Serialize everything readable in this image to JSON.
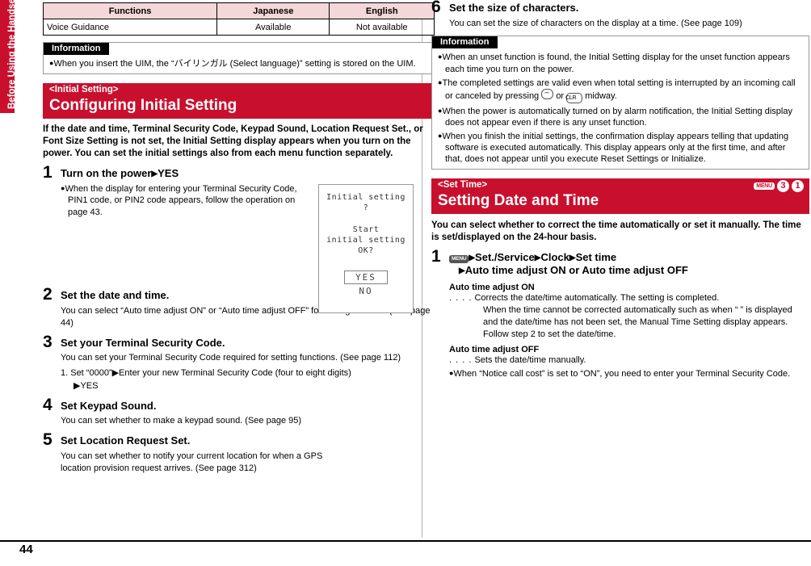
{
  "side_tab": {
    "label": "Before Using the Handset"
  },
  "page_number": "44",
  "left": {
    "table": {
      "headers": [
        "Functions",
        "Japanese",
        "English"
      ],
      "rows": [
        [
          "Voice Guidance",
          "Available",
          "Not available"
        ]
      ]
    },
    "information": {
      "title": "Information",
      "items": [
        "When you insert the UIM, the “バイリンガル (Select language)” setting is stored on the UIM."
      ]
    },
    "section": {
      "sub": "<Initial Setting>",
      "title": "Configuring Initial Setting"
    },
    "intro": "If the date and time, Terminal Security Code, Keypad Sound, Location Request Set., or Font Size Setting is not set, the Initial Setting display appears when you turn on the power. You can set the initial settings also from each menu function separately.",
    "steps": [
      {
        "num": "1",
        "title_main": "Turn on the power",
        "title_arrow": "▶",
        "title_rest": "YES",
        "bullets": [
          "When the display for entering your Terminal Security Code, PIN1 code, or PIN2 code appears, follow the operation on page 43."
        ]
      },
      {
        "num": "2",
        "title_main": "Set the date and time.",
        "body": "You can select “Auto time adjust ON” or “Auto time adjust OFF” for setting the time. (See page 44)"
      },
      {
        "num": "3",
        "title_main": "Set your Terminal Security Code.",
        "body": "You can set your Terminal Security Code required for setting functions. (See page 112)",
        "sub_lines": [
          "1. Set “0000”▶Enter your new Terminal Security Code (four to eight digits)",
          "▶YES"
        ]
      },
      {
        "num": "4",
        "title_main": "Set Keypad Sound.",
        "body": "You can set whether to make a keypad sound. (See page 95)"
      },
      {
        "num": "5",
        "title_main": "Set Location Request Set.",
        "body": "You can set whether to notify your current location for when a GPS location provision request arrives. (See page 312)"
      }
    ],
    "step3_line1_prefix": "1.",
    "step3_line1_text": "Set “0000”",
    "phone_shot": {
      "line1": "Initial setting",
      "line2": "?",
      "line3": "Start",
      "line4": "initial setting",
      "line5": "OK?",
      "yes": "YES",
      "no": "NO"
    }
  },
  "right": {
    "step6": {
      "num": "6",
      "title": "Set the size of characters.",
      "body": "You can set the size of characters on the display at a time. (See page 109)"
    },
    "information": {
      "title": "Information",
      "items": [
        "When an unset function is found, the Initial Setting display for the unset function appears each time you turn on the power.",
        "The completed settings are valid even when total setting is interrupted by an incoming call or canceled by pressing ( ) or (CLR) midway.",
        "When the power is automatically turned on by alarm notification, the Initial Setting display does not appear even if there is any unset function.",
        "When you finish the initial settings, the confirmation display appears telling that updating software is executed automatically. This display appears only at the first time, and after that, does not appear until you execute Reset Settings or Initialize."
      ],
      "item2_parts": {
        "pre": "The completed settings are valid even when total setting is interrupted by an incoming",
        "mid1": "call or canceled by pressing",
        "mid2": "or",
        "clr_label": "CLR",
        "post": "midway."
      }
    },
    "section": {
      "sub": "<Set Time>",
      "title": "Setting Date and Time",
      "key_menu": "MENU",
      "key_num1": "3",
      "key_num2": "1"
    },
    "intro": "You can select whether to correct the time automatically or set it manually. The time is set/displayed on the 24-hour basis.",
    "step1": {
      "num": "1",
      "menu_key": "MENU",
      "title_line1_arrow1": "▶",
      "title_line1_a": "Set./Service",
      "title_line1_arrow2": "▶",
      "title_line1_b": "Clock",
      "title_line1_arrow3": "▶",
      "title_line1_c": "Set time",
      "title_line2_arrow": "▶",
      "title_line2": "Auto time adjust ON or Auto time adjust OFF"
    },
    "definitions": [
      {
        "term": "Auto time adjust ON",
        "lead": ". . . .",
        "text": "Corrects the date/time automatically. The setting is completed.",
        "cont": "When the time cannot be corrected automatically such as when “ ” is displayed and the date/time has not been set, the Manual Time Setting display appears. Follow step 2 to set the date/time."
      },
      {
        "term": "Auto time adjust OFF",
        "lead": ". . . .",
        "text": "Sets the date/time manually.",
        "cont": ""
      }
    ],
    "final_bullet": "When “Notice call cost” is set to “ON”, you need to enter your Terminal Security Code."
  }
}
